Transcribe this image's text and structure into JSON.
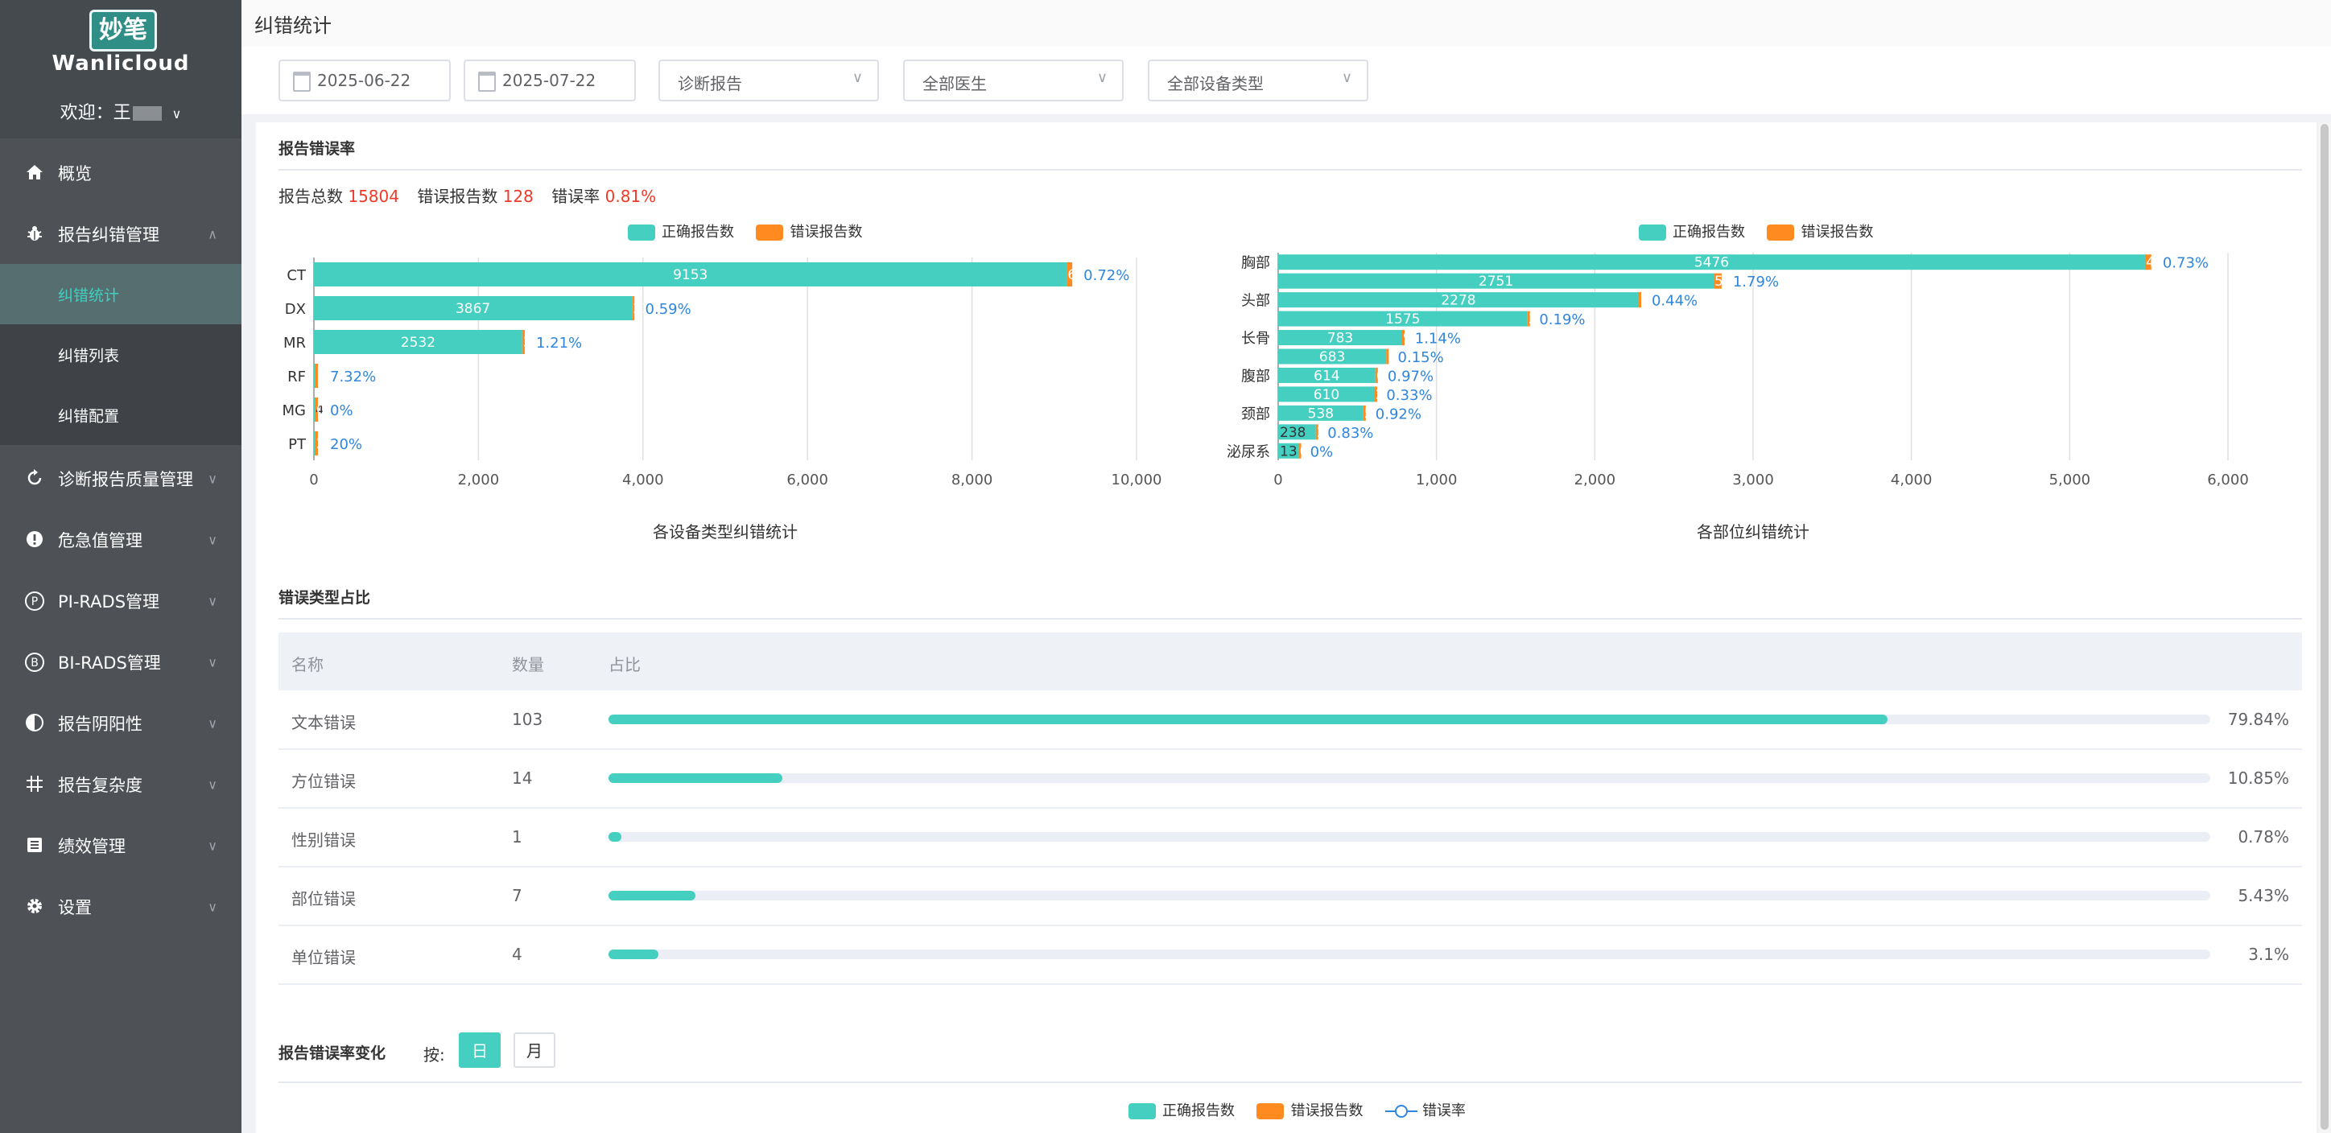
{
  "brand": {
    "logo_text": "妙笔",
    "name": "Wanlicloud",
    "welcome": "欢迎：王"
  },
  "sidebar": {
    "items": [
      {
        "label": "概览",
        "icon": "home-icon"
      },
      {
        "label": "报告纠错管理",
        "icon": "bug-icon",
        "expanded": true,
        "children": [
          {
            "label": "纠错统计",
            "active": true
          },
          {
            "label": "纠错列表"
          },
          {
            "label": "纠错配置"
          }
        ]
      },
      {
        "label": "诊断报告质量管理",
        "icon": "refresh-icon"
      },
      {
        "label": "危急值管理",
        "icon": "alert-icon"
      },
      {
        "label": "PI-RADS管理",
        "icon": "p-circle-icon"
      },
      {
        "label": "BI-RADS管理",
        "icon": "b-circle-icon"
      },
      {
        "label": "报告阴阳性",
        "icon": "half-circle-icon"
      },
      {
        "label": "报告复杂度",
        "icon": "grid-icon"
      },
      {
        "label": "绩效管理",
        "icon": "list-icon"
      },
      {
        "label": "设置",
        "icon": "gear-icon"
      }
    ]
  },
  "header": {
    "title": "纠错统计"
  },
  "filters": {
    "start_date": "2025-06-22",
    "end_date": "2025-07-22",
    "report_type": "诊断报告",
    "doctor": "全部医生",
    "device_type": "全部设备类型"
  },
  "error_rate": {
    "title": "报告错误率",
    "total_label": "报告总数",
    "total": "15804",
    "error_label": "错误报告数",
    "error_count": "128",
    "rate_label": "错误率",
    "rate": "0.81%"
  },
  "legend": {
    "correct": "正确报告数",
    "error": "错误报告数",
    "rate": "错误率"
  },
  "colors": {
    "correct": "#45cfc0",
    "error": "#ff8a1f",
    "rate": "#2e86de",
    "red": "#f03a2a"
  },
  "chart_data": [
    {
      "type": "bar",
      "orientation": "horizontal",
      "stacked": true,
      "title": "各设备类型纠错统计",
      "categories": [
        "CT",
        "DX",
        "MR",
        "RF",
        "MG",
        "PT"
      ],
      "series": [
        {
          "name": "正确报告数",
          "values": [
            9153,
            3867,
            2532,
            12,
            4,
            1
          ]
        },
        {
          "name": "错误报告数",
          "values": [
            66,
            23,
            31,
            1,
            0,
            2
          ]
        }
      ],
      "bar_labels": [
        {
          "correct": "9153",
          "error": "66"
        },
        {
          "correct": "3867",
          "error": "23"
        },
        {
          "correct": "2532",
          "error": "31"
        },
        {
          "correct": "",
          "error": "1"
        },
        {
          "correct": "4",
          "error": "0"
        },
        {
          "correct": "",
          "error": "2"
        }
      ],
      "rate_labels": [
        "0.72%",
        "0.59%",
        "1.21%",
        "7.32%",
        "0%",
        "20%"
      ],
      "xlim": [
        0,
        10000
      ],
      "xticks": [
        "0",
        "2,000",
        "4,000",
        "6,000",
        "8,000",
        "10,000"
      ],
      "grid": true,
      "legend_position": "top"
    },
    {
      "type": "bar",
      "orientation": "horizontal",
      "stacked": true,
      "title": "各部位纠错统计",
      "categories": [
        "胸部",
        "",
        "头部",
        "",
        "长骨",
        "",
        "腹部",
        "",
        "颈部",
        "",
        "泌尿系"
      ],
      "series": [
        {
          "name": "正确报告数",
          "values": [
            5476,
            2751,
            2278,
            1575,
            783,
            683,
            614,
            610,
            538,
            238,
            130
          ]
        },
        {
          "name": "错误报告数",
          "values": [
            40,
            50,
            10,
            3,
            9,
            1,
            6,
            2,
            5,
            2,
            0
          ]
        }
      ],
      "bar_labels": [
        {
          "correct": "5476",
          "error": "4"
        },
        {
          "correct": "2751",
          "error": "50"
        },
        {
          "correct": "2278",
          "error": "10"
        },
        {
          "correct": "1575",
          "error": "3"
        },
        {
          "correct": "783",
          "error": "9"
        },
        {
          "correct": "683",
          "error": "1"
        },
        {
          "correct": "614",
          "error": "6"
        },
        {
          "correct": "610",
          "error": "2"
        },
        {
          "correct": "538",
          "error": "5"
        },
        {
          "correct": "238",
          "error": "2"
        },
        {
          "correct": "13",
          "error": "0"
        }
      ],
      "rate_labels": [
        "0.73%",
        "1.79%",
        "0.44%",
        "0.19%",
        "1.14%",
        "0.15%",
        "0.97%",
        "0.33%",
        "0.92%",
        "0.83%",
        "0%"
      ],
      "xlim": [
        0,
        6000
      ],
      "xticks": [
        "0",
        "1,000",
        "2,000",
        "3,000",
        "4,000",
        "5,000",
        "6,000"
      ],
      "grid": true,
      "legend_position": "top"
    }
  ],
  "error_types": {
    "title": "错误类型占比",
    "headers": {
      "name": "名称",
      "count": "数量",
      "ratio": "占比"
    },
    "rows": [
      {
        "name": "文本错误",
        "count": "103",
        "ratio": 79.84,
        "ratio_label": "79.84%"
      },
      {
        "name": "方位错误",
        "count": "14",
        "ratio": 10.85,
        "ratio_label": "10.85%"
      },
      {
        "name": "性别错误",
        "count": "1",
        "ratio": 0.78,
        "ratio_label": "0.78%"
      },
      {
        "name": "部位错误",
        "count": "7",
        "ratio": 5.43,
        "ratio_label": "5.43%"
      },
      {
        "name": "单位错误",
        "count": "4",
        "ratio": 3.1,
        "ratio_label": "3.1%"
      }
    ]
  },
  "trend": {
    "title": "报告错误率变化",
    "by_label": "按:",
    "day_label": "日",
    "month_label": "月",
    "selected": "日"
  }
}
